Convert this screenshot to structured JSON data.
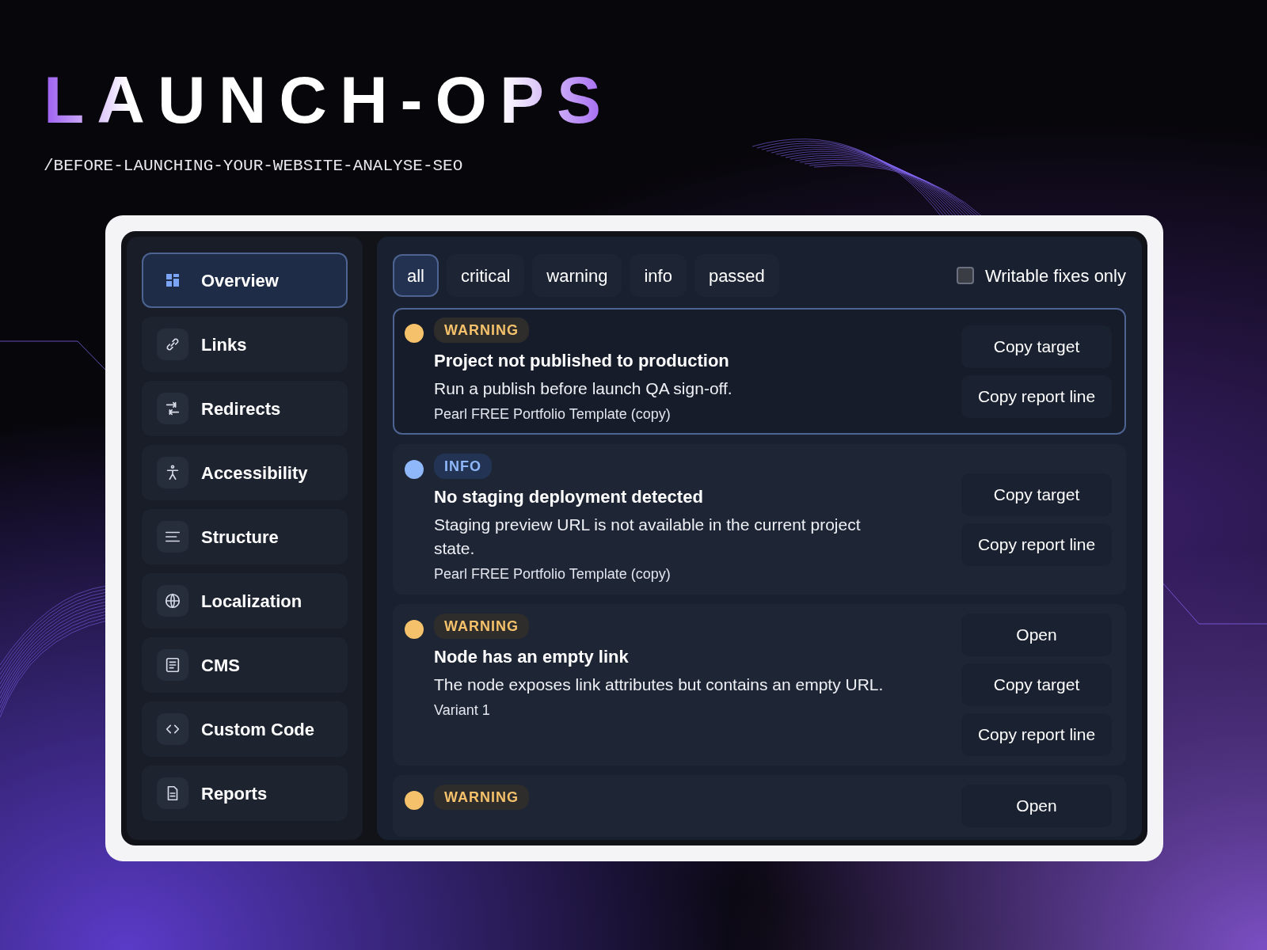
{
  "brand": {
    "title": "LAUNCH-OPS",
    "subtitle": "/BEFORE-LAUNCHING-YOUR-WEBSITE-ANALYSE-SEO"
  },
  "sidebar": {
    "items": [
      {
        "label": "Overview",
        "kind": "grid",
        "selected": true
      },
      {
        "label": "Links",
        "kind": "link",
        "selected": false
      },
      {
        "label": "Redirects",
        "kind": "redirect",
        "selected": false
      },
      {
        "label": "Accessibility",
        "kind": "person",
        "selected": false
      },
      {
        "label": "Structure",
        "kind": "lines",
        "selected": false
      },
      {
        "label": "Localization",
        "kind": "globe",
        "selected": false
      },
      {
        "label": "CMS",
        "kind": "doclines",
        "selected": false
      },
      {
        "label": "Custom Code",
        "kind": "code",
        "selected": false
      },
      {
        "label": "Reports",
        "kind": "file",
        "selected": false
      }
    ]
  },
  "filters": [
    {
      "label": "all",
      "selected": true
    },
    {
      "label": "critical",
      "selected": false
    },
    {
      "label": "warning",
      "selected": false
    },
    {
      "label": "info",
      "selected": false
    },
    {
      "label": "passed",
      "selected": false
    }
  ],
  "writable_fixes": {
    "label": "Writable fixes only",
    "checked": false
  },
  "issues": [
    {
      "kind": "warning",
      "badge": "WARNING",
      "color": "#f5c26b",
      "selected": true,
      "title": "Project not published to production",
      "description": "Run a publish before launch QA sign-off.",
      "target": "Pearl FREE Portfolio Template (copy)",
      "actions": [
        "Copy target",
        "Copy report line"
      ]
    },
    {
      "kind": "info",
      "badge": "INFO",
      "color": "#8fb8fa",
      "selected": false,
      "title": "No staging deployment detected",
      "description": "Staging preview URL is not available in the current project state.",
      "target": "Pearl FREE Portfolio Template (copy)",
      "actions": [
        "Copy target",
        "Copy report line"
      ]
    },
    {
      "kind": "warning",
      "badge": "WARNING",
      "color": "#f5c26b",
      "selected": false,
      "title": "Node has an empty link",
      "description": "The node exposes link attributes but contains an empty URL.",
      "target": "Variant 1",
      "actions": [
        "Open",
        "Copy target",
        "Copy report line"
      ]
    },
    {
      "kind": "warning",
      "badge": "WARNING",
      "color": "#f5c26b",
      "selected": false,
      "actions": [
        "Open"
      ]
    }
  ]
}
